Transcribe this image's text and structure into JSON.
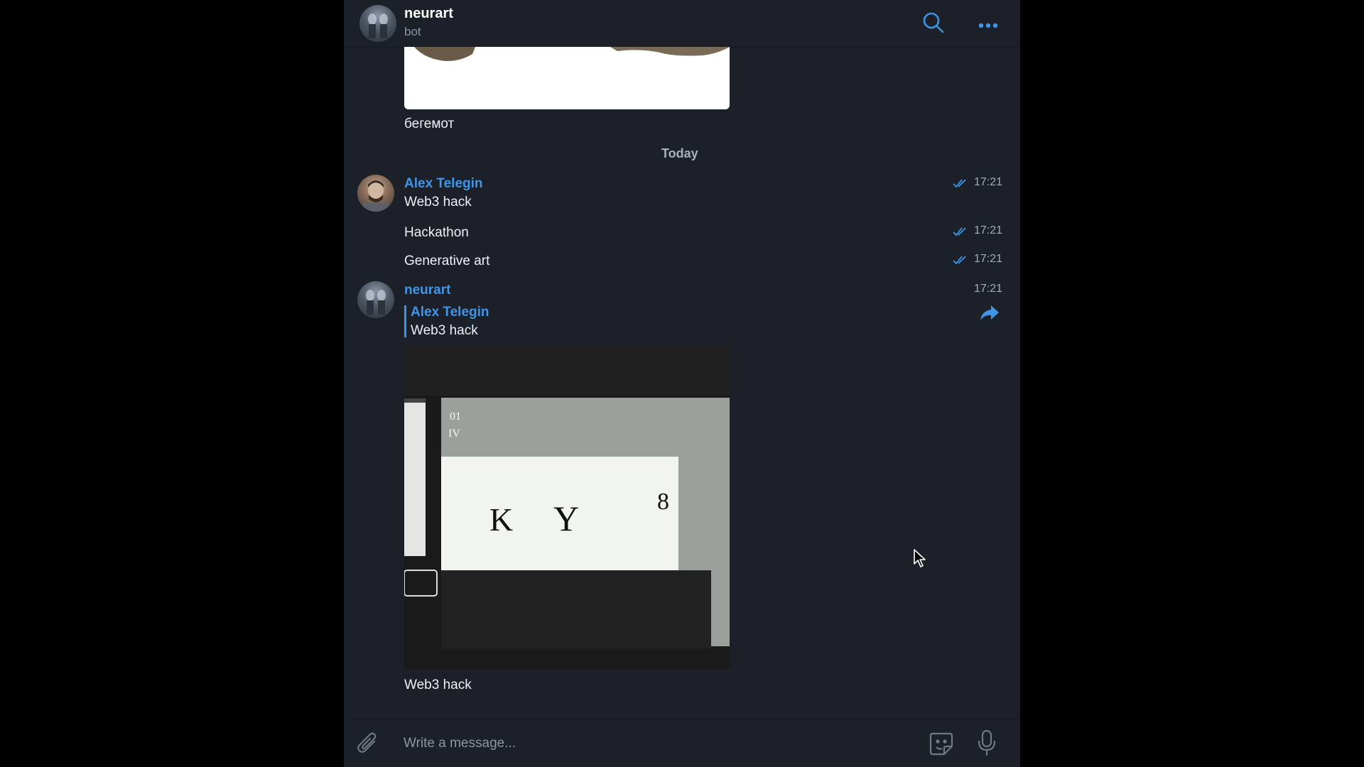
{
  "header": {
    "title": "neurart",
    "subtitle": "bot"
  },
  "previous": {
    "caption": "бегемот"
  },
  "date_separator": "Today",
  "messages": [
    {
      "sender": "Alex Telegin",
      "text": "Web3 hack",
      "time": "17:21",
      "read": true
    },
    {
      "text": "Hackathon",
      "time": "17:21",
      "read": true
    },
    {
      "text": "Generative art",
      "time": "17:21",
      "read": true
    }
  ],
  "bot_message": {
    "sender": "neurart",
    "time": "17:21",
    "reply_to": {
      "sender": "Alex Telegin",
      "text": "Web3 hack"
    },
    "caption": "Web3 hack"
  },
  "composer": {
    "placeholder": "Write a message..."
  },
  "colors": {
    "accent": "#3f95e8",
    "background": "#1b2029"
  },
  "icons": [
    "search-icon",
    "more-icon",
    "read-checks-icon",
    "forward-icon",
    "attach-icon",
    "sticker-icon",
    "microphone-icon"
  ]
}
